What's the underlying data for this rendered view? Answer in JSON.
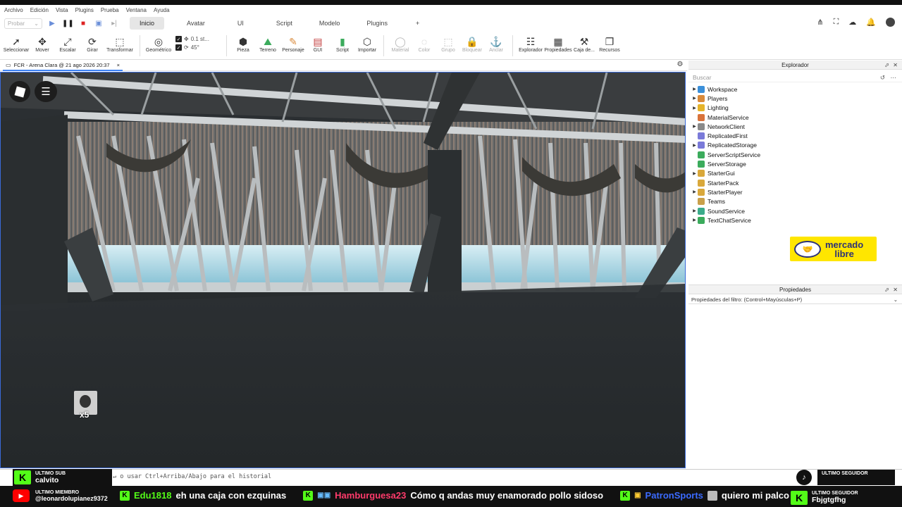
{
  "menu": [
    "Archivo",
    "Edición",
    "Vista",
    "Plugins",
    "Prueba",
    "Ventana",
    "Ayuda"
  ],
  "play": {
    "label": "Probar"
  },
  "ribbon_tabs": [
    "Inicio",
    "Avatar",
    "UI",
    "Script",
    "Modelo",
    "Plugins",
    "+"
  ],
  "active_tab": "Inicio",
  "tools": {
    "select": "Seleccionar",
    "move": "Mover",
    "scale": "Escalar",
    "rotate": "Girar",
    "transform": "Transformar",
    "geometric": "Geométrico",
    "snap_move": "0.1 st...",
    "snap_rotate": "45°",
    "part": "Pieza",
    "terrain": "Terreno",
    "character": "Personaje",
    "gui": "GUI",
    "script": "Script",
    "import": "Importar",
    "material": "Material",
    "color": "Color",
    "group": "Grupo",
    "lock": "Bloquear",
    "anchor": "Anclar",
    "explorer": "Explorador",
    "properties": "Propiedades",
    "toolbox": "Caja de...",
    "assets": "Recursos"
  },
  "document_tab": {
    "title": "FCR - Arena Clara @ 21 ago 2026 20:37",
    "close": "×"
  },
  "explorer": {
    "title": "Explorador",
    "search_placeholder": "Buscar",
    "items": [
      {
        "name": "Workspace",
        "expandable": true,
        "icon": "workspace-icon",
        "color": "#3b8fd9"
      },
      {
        "name": "Players",
        "expandable": true,
        "icon": "players-icon",
        "color": "#d98a3b"
      },
      {
        "name": "Lighting",
        "expandable": true,
        "icon": "lighting-icon",
        "color": "#e5b42b"
      },
      {
        "name": "MaterialService",
        "expandable": false,
        "icon": "material-service-icon",
        "color": "#d9733b"
      },
      {
        "name": "NetworkClient",
        "expandable": true,
        "icon": "network-client-icon",
        "color": "#8a8a8a"
      },
      {
        "name": "ReplicatedFirst",
        "expandable": false,
        "icon": "replicated-first-icon",
        "color": "#7a7ad9"
      },
      {
        "name": "ReplicatedStorage",
        "expandable": true,
        "icon": "replicated-storage-icon",
        "color": "#7a7ad9"
      },
      {
        "name": "ServerScriptService",
        "expandable": false,
        "icon": "server-script-service-icon",
        "color": "#3bab5c"
      },
      {
        "name": "ServerStorage",
        "expandable": false,
        "icon": "server-storage-icon",
        "color": "#3bab5c"
      },
      {
        "name": "StarterGui",
        "expandable": true,
        "icon": "starter-gui-icon",
        "color": "#d9a83b"
      },
      {
        "name": "StarterPack",
        "expandable": false,
        "icon": "starter-pack-icon",
        "color": "#d9a83b"
      },
      {
        "name": "StarterPlayer",
        "expandable": true,
        "icon": "starter-player-icon",
        "color": "#d9a83b"
      },
      {
        "name": "Teams",
        "expandable": false,
        "icon": "teams-icon",
        "color": "#c9a04a"
      },
      {
        "name": "SoundService",
        "expandable": true,
        "icon": "sound-service-icon",
        "color": "#3bab8a"
      },
      {
        "name": "TextChatService",
        "expandable": true,
        "icon": "text-chat-service-icon",
        "color": "#3bab5c"
      }
    ]
  },
  "sponsor": {
    "line1": "mercado",
    "line2": "libre"
  },
  "properties": {
    "title": "Propiedades",
    "filter_placeholder": "Propiedades del filtro: (Control+Mayúsculas+P)"
  },
  "command_bar": {
    "hint": "↵ o usar Ctrl+Arriba/Abajo para el historial"
  },
  "viewport": {
    "avatar_badge": "x5"
  },
  "stream": {
    "last_sub_label": "ULTIMO SUB",
    "last_sub": "calvito",
    "last_member_label": "ULTIMO MIEMBRO",
    "last_member": "@leonardolupianez9372",
    "last_follower_label": "ULTIMO SEGUIDOR",
    "last_follower": "Fbjgtgfhg",
    "chat": [
      {
        "user": "Edu1818",
        "msg": "eh una caja con ezquinas",
        "color": "#53fc18"
      },
      {
        "user": "Hamburguesa23",
        "msg": "Cómo q andas muy enamorado pollo sidoso",
        "color": "#ff3b6b"
      },
      {
        "user": "PatronSports",
        "msg": "quiero mi palco",
        "color": "#3b6bff"
      }
    ]
  }
}
